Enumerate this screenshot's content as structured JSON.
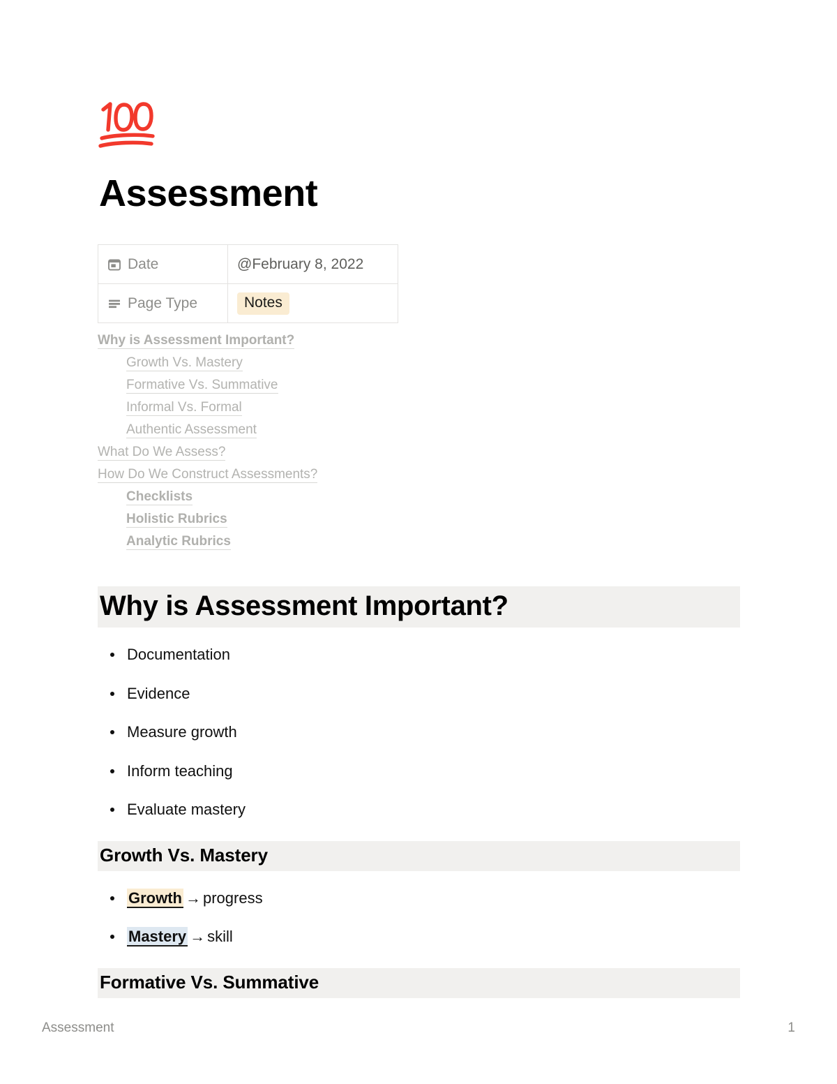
{
  "document": {
    "icon": "hundred-points-emoji",
    "title": "Assessment"
  },
  "properties": {
    "rows": [
      {
        "icon": "calendar-icon",
        "key": "Date",
        "value": "@February 8, 2022",
        "value_type": "text"
      },
      {
        "icon": "list-lines-icon",
        "key": "Page Type",
        "value": "Notes",
        "value_type": "tag",
        "tag_color": "#faecd2"
      }
    ]
  },
  "table_of_contents": [
    {
      "label": "Why is Assessment Important?",
      "level": 1,
      "bold": true
    },
    {
      "label": "Growth Vs. Mastery",
      "level": 2,
      "bold": false
    },
    {
      "label": "Formative Vs. Summative",
      "level": 2,
      "bold": false
    },
    {
      "label": "Informal Vs. Formal",
      "level": 2,
      "bold": false
    },
    {
      "label": "Authentic Assessment",
      "level": 2,
      "bold": false
    },
    {
      "label": "What Do We Assess?",
      "level": 1,
      "bold": false
    },
    {
      "label": "How Do We Construct Assessments?",
      "level": 1,
      "bold": false
    },
    {
      "label": "Checklists",
      "level": 2,
      "bold": true
    },
    {
      "label": "Holistic Rubrics",
      "level": 2,
      "bold": true
    },
    {
      "label": "Analytic Rubrics",
      "level": 2,
      "bold": true
    }
  ],
  "sections": {
    "why_important": {
      "heading": "Why is Assessment Important?",
      "bullets": [
        "Documentation",
        "Evidence",
        "Measure growth",
        "Inform teaching",
        "Evaluate mastery"
      ]
    },
    "growth_vs_mastery": {
      "heading": "Growth Vs. Mastery",
      "bullets": [
        {
          "term": "Growth",
          "arrow": "→",
          "definition": "progress",
          "highlight": "#faecd2"
        },
        {
          "term": "Mastery",
          "arrow": "→",
          "definition": "skill",
          "highlight": "#dee8f1"
        }
      ]
    },
    "formative_vs_summative": {
      "heading": "Formative Vs. Summative"
    }
  },
  "footer": {
    "left": "Assessment",
    "page_number": "1"
  },
  "colors": {
    "heading_band": "#f1f0ee",
    "emoji_red": "#f2392c",
    "toc_text": "#b3b3b0",
    "tag_tan": "#faecd2",
    "tag_blue": "#dee8f1"
  }
}
